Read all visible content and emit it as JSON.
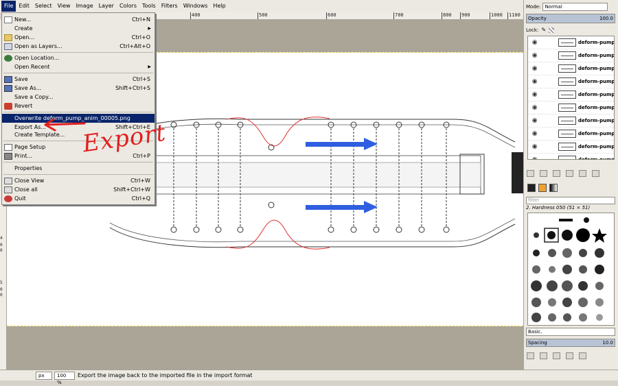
{
  "menubar": {
    "items": [
      "File",
      "Edit",
      "Select",
      "View",
      "Image",
      "Layer",
      "Colors",
      "Tools",
      "Filters",
      "Windows",
      "Help"
    ]
  },
  "ruler": {
    "top_ticks": [
      "400",
      "500",
      "600",
      "700",
      "800",
      "900",
      "1000",
      "1100"
    ],
    "left_ticks": [
      "4",
      "0",
      "0",
      "5",
      "0",
      "0"
    ]
  },
  "file_menu": {
    "items": [
      {
        "label": "New...",
        "shortcut": "Ctrl+N",
        "icon": "new-file-icon"
      },
      {
        "label": "Create",
        "shortcut": "",
        "submenu": true
      },
      {
        "label": "Open...",
        "shortcut": "Ctrl+O",
        "icon": "open-folder-icon"
      },
      {
        "label": "Open as Layers...",
        "shortcut": "Ctrl+Alt+O",
        "icon": "open-layers-icon"
      },
      {
        "label": "Open Location...",
        "shortcut": "",
        "icon": "globe-icon"
      },
      {
        "label": "Open Recent",
        "shortcut": "",
        "submenu": true
      },
      {
        "label": "Save",
        "shortcut": "Ctrl+S",
        "icon": "save-icon"
      },
      {
        "label": "Save As...",
        "shortcut": "Shift+Ctrl+S",
        "icon": "save-as-icon"
      },
      {
        "label": "Save a Copy...",
        "shortcut": ""
      },
      {
        "label": "Revert",
        "shortcut": "",
        "icon": "revert-icon"
      },
      {
        "label": "Overwrite deform_pump_anim_00005.png",
        "shortcut": ""
      },
      {
        "label": "Export As...",
        "shortcut": "Shift+Ctrl+E"
      },
      {
        "label": "Create Template...",
        "shortcut": ""
      },
      {
        "label": "Page Setup",
        "shortcut": "",
        "icon": "page-setup-icon"
      },
      {
        "label": "Print...",
        "shortcut": "Ctrl+P",
        "icon": "print-icon"
      },
      {
        "label": "Properties",
        "shortcut": ""
      },
      {
        "label": "Close View",
        "shortcut": "Ctrl+W",
        "icon": "close-view-icon"
      },
      {
        "label": "Close all",
        "shortcut": "Shift+Ctrl+W",
        "icon": "close-all-icon"
      },
      {
        "label": "Quit",
        "shortcut": "Ctrl+Q",
        "icon": "quit-icon"
      }
    ]
  },
  "annotation": {
    "text": "Export"
  },
  "right_panel": {
    "mode_label": "Mode:",
    "mode_value": "Normal",
    "opacity_label": "Opacity",
    "opacity_value": "100.0",
    "lock_label": "Lock:",
    "layers": [
      "deform-pump",
      "deform-pump",
      "deform-pump",
      "deform-pump",
      "deform-pump",
      "deform-pump",
      "deform-pump",
      "deform-pump",
      "deform-pump",
      "deform-pump"
    ],
    "filter_placeholder": "filter",
    "brush_name": "2. Hardness 050 (51 × 51)",
    "brush_preset": "Basic.",
    "spacing_label": "Spacing",
    "spacing_value": "10.0"
  },
  "statusbar": {
    "unit": "px",
    "zoom": "100 %",
    "message": "Export the image back to the imported file in the import format"
  },
  "colors": {
    "menu_highlight": "#0a246a",
    "canvas_bg": "#ffffff",
    "blue_arrow": "#2f5fe0",
    "red_annotation": "#e02020"
  }
}
